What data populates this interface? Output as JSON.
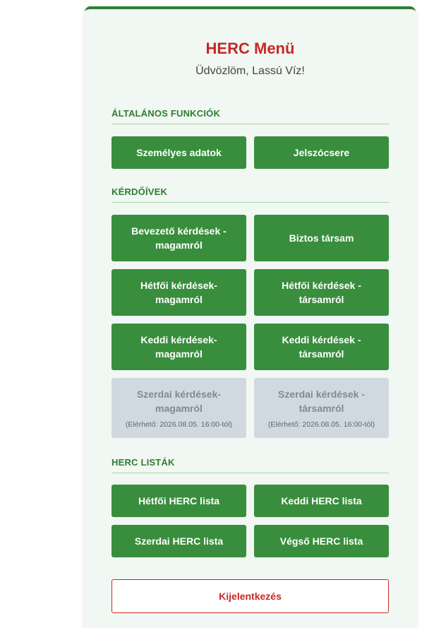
{
  "header": {
    "title": "HERC Menü",
    "welcome": "Üdvözlöm, Lassú Víz!"
  },
  "sections": {
    "general": {
      "title": "ÁLTALÁNOS FUNKCIÓK",
      "buttons": [
        "Személyes adatok",
        "Jelszócsere"
      ]
    },
    "questionnaires": {
      "title": "KÉRDŐÍVEK",
      "buttons": [
        "Bevezető kérdések - magamról",
        "Biztos társam",
        "Hétfői kérdések-magamról",
        "Hétfői kérdések - társamról",
        "Keddi kérdések-magamról",
        "Keddi kérdések - társamról",
        "Szerdai kérdések-magamról",
        "Szerdai kérdések - társamról"
      ],
      "availability": [
        "(Elérhető: 2026.08.05. 16:00-tól)",
        "(Elérhető: 2026.08.05. 16:00-tól)"
      ]
    },
    "lists": {
      "title": "HERC LISTÁK",
      "buttons": [
        "Hétfői HERC lista",
        "Keddi HERC lista",
        "Szerdai HERC lista",
        "Végső HERC lista"
      ]
    }
  },
  "logout": {
    "label": "Kijelentkezés"
  },
  "colors": {
    "primary_green": "#388e3c",
    "accent_red": "#c62828",
    "disabled_gray": "#d1d9e0"
  }
}
